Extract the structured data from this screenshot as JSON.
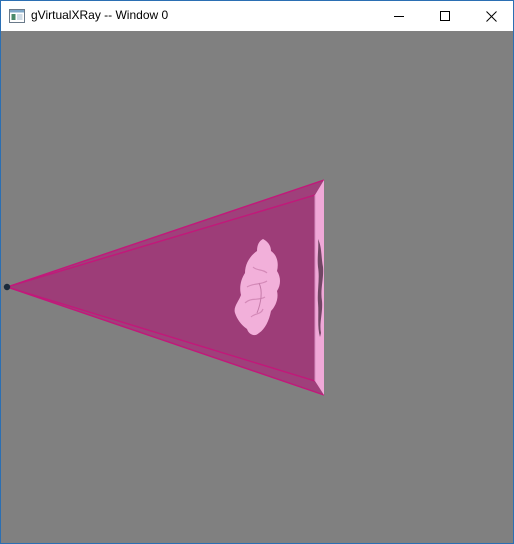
{
  "window": {
    "title": "gVirtualXRay -- Window 0",
    "icon": "app-window-icon",
    "controls": {
      "minimize_icon": "minimize-icon",
      "maximize_icon": "maximize-icon",
      "close_icon": "close-icon"
    }
  },
  "viewport": {
    "background_color": "#808080",
    "beam_color": "#a03c7a",
    "beam_edge_color": "#c2187a",
    "detector_color": "#f0a8d8",
    "object_color": "#f2b0da",
    "source_color": "#1a2a3a"
  }
}
